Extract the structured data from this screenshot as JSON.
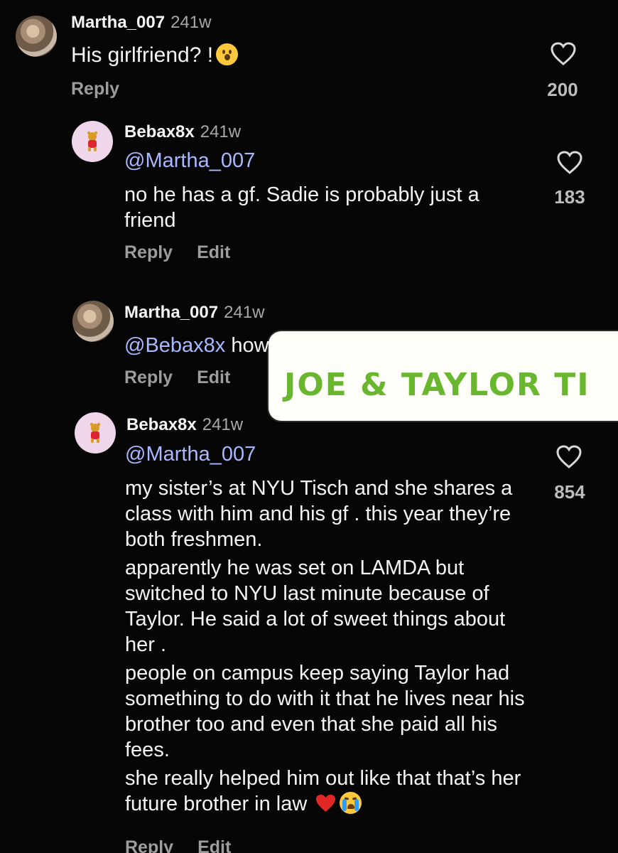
{
  "comments": [
    {
      "username": "Martha_007",
      "time": "241w",
      "text": "His girlfriend? !",
      "emoji": "astonished-face",
      "actions": [
        "Reply"
      ],
      "likes": "200",
      "avatar": "photo"
    },
    {
      "username": "Bebax8x",
      "time": "241w",
      "mention": "@Martha_007",
      "text": "no he has a gf. Sadie is probably just a friend",
      "actions": [
        "Reply",
        "Edit"
      ],
      "likes": "183",
      "avatar": "pooh"
    },
    {
      "username": "Martha_007",
      "time": "241w",
      "mention": "@Bebax8x",
      "text": "how do u know",
      "actions": [
        "Reply",
        "Edit"
      ],
      "avatar": "photo"
    },
    {
      "username": "Bebax8x",
      "time": "241w",
      "mention": "@Martha_007",
      "paragraphs": [
        "my sister’s at NYU Tisch and she shares a class with him and his gf . this year they’re both freshmen.",
        "apparently he was set on LAMDA but switched to NYU last minute because of Taylor. He said a lot of sweet things about her .",
        "people on campus keep saying Taylor had something to do with it that he lives near his brother too and even that she paid all his fees.",
        "she really helped him out like that that’s her future brother in law"
      ],
      "trailing_emojis": [
        "red-heart",
        "loudly-crying-face"
      ],
      "actions": [
        "Reply",
        "Edit"
      ],
      "likes": "854",
      "avatar": "pooh"
    }
  ],
  "overlay": {
    "text": "JOE & TAYLOR TI",
    "background": "#fffef8",
    "color": "#68b72e"
  },
  "colors": {
    "background": "#060607",
    "mention": "#a9b8ff",
    "secondary": "#9d9d9d",
    "heart_emoji": "#e32727"
  },
  "icons": {
    "like": "heart-outline-icon"
  }
}
